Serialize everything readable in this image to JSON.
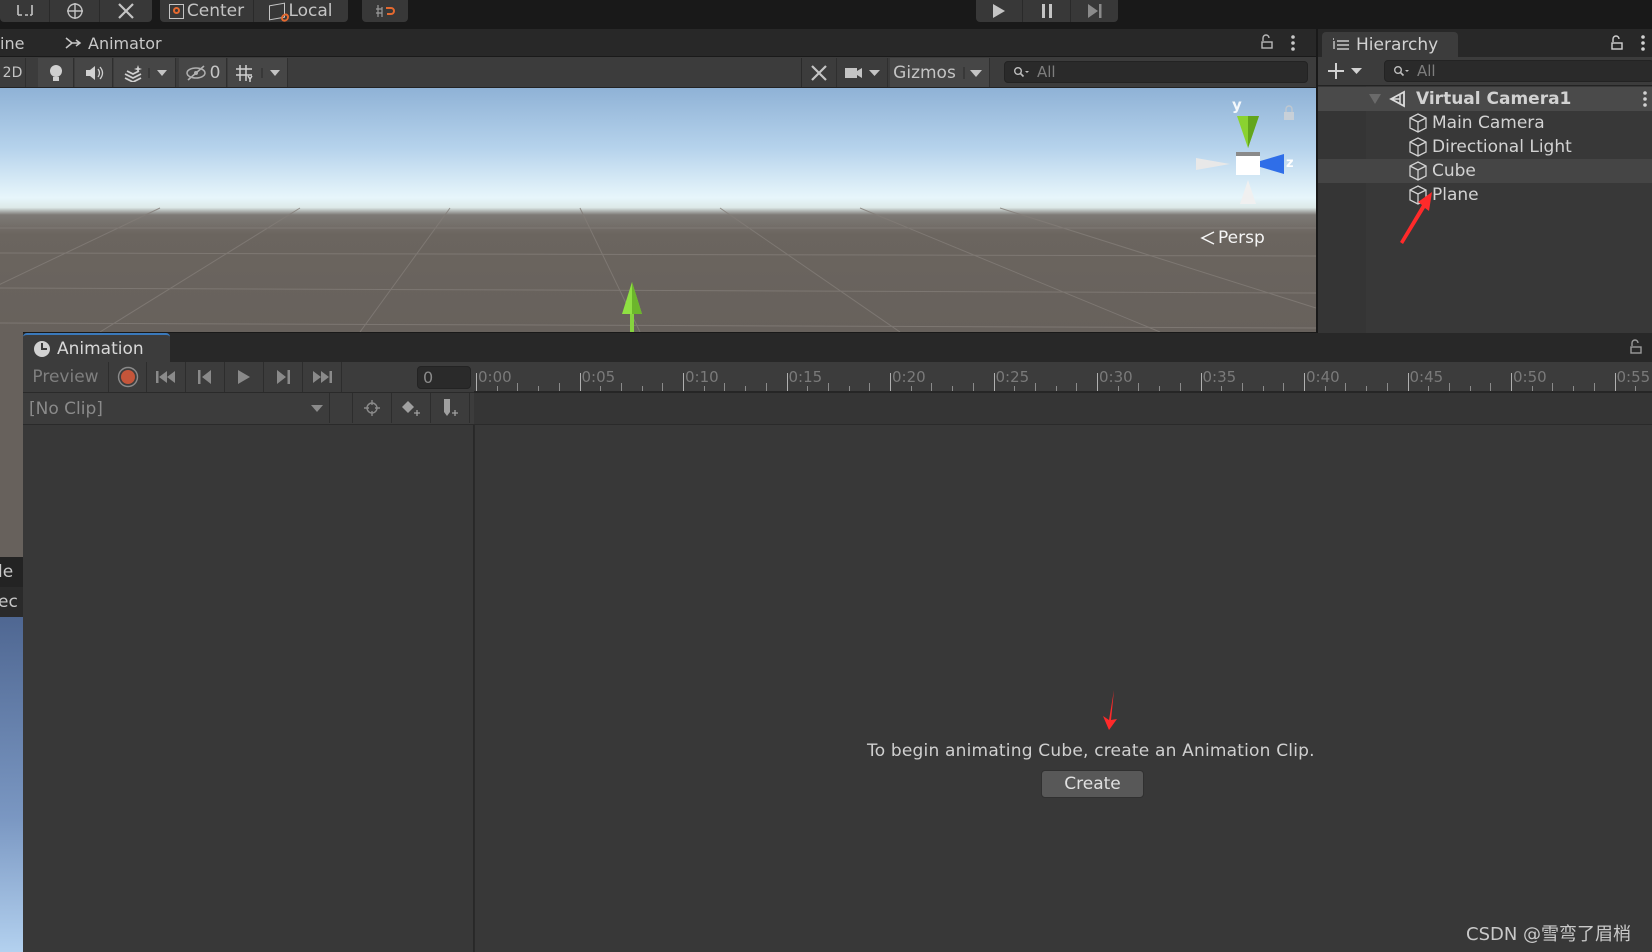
{
  "toolbar": {
    "tools": [
      "rect-tool-icon",
      "transform-tool-icon",
      "custom-tool-icon"
    ],
    "pivot_label": "Center",
    "space_label": "Local",
    "snap_icon": "increment-snap-icon",
    "play_controls": [
      "play-icon",
      "pause-icon",
      "step-icon"
    ]
  },
  "tabs": {
    "partial_left": "ine",
    "animator": "Animator"
  },
  "scene_toolbar": {
    "mode_2d": "2D",
    "hidden_count": "0",
    "gizmos_label": "Gizmos",
    "search_placeholder": "All"
  },
  "scene": {
    "gizmo_axis_y": "y",
    "gizmo_axis_z": "z",
    "projection_label": "Persp"
  },
  "hierarchy": {
    "title": "Hierarchy",
    "search_placeholder": "All",
    "root": "Virtual Camera1",
    "items": [
      {
        "label": "Main Camera",
        "selected": false
      },
      {
        "label": "Directional Light",
        "selected": false
      },
      {
        "label": "Cube",
        "selected": true
      },
      {
        "label": "Plane",
        "selected": false
      }
    ]
  },
  "left_panel_partial": {
    "line1": "le",
    "line2": "ec"
  },
  "animation": {
    "title": "Animation",
    "preview_label": "Preview",
    "frame_value": "0",
    "clip_select": "[No Clip]",
    "ruler_labels": [
      "0:00",
      "0:05",
      "0:10",
      "0:15",
      "0:20",
      "0:25",
      "0:30",
      "0:35",
      "0:40",
      "0:45",
      "0:50",
      "0:55"
    ],
    "empty_message": "To begin animating Cube, create an Animation Clip.",
    "create_label": "Create"
  },
  "colors": {
    "record": "#c4553a",
    "accent_tab": "#3a79bb",
    "annotation_arrow": "#ff2a2a",
    "gizmo_y": "#8ad230",
    "gizmo_z": "#2f6ee8"
  },
  "watermark": "CSDN @雪弯了眉梢"
}
